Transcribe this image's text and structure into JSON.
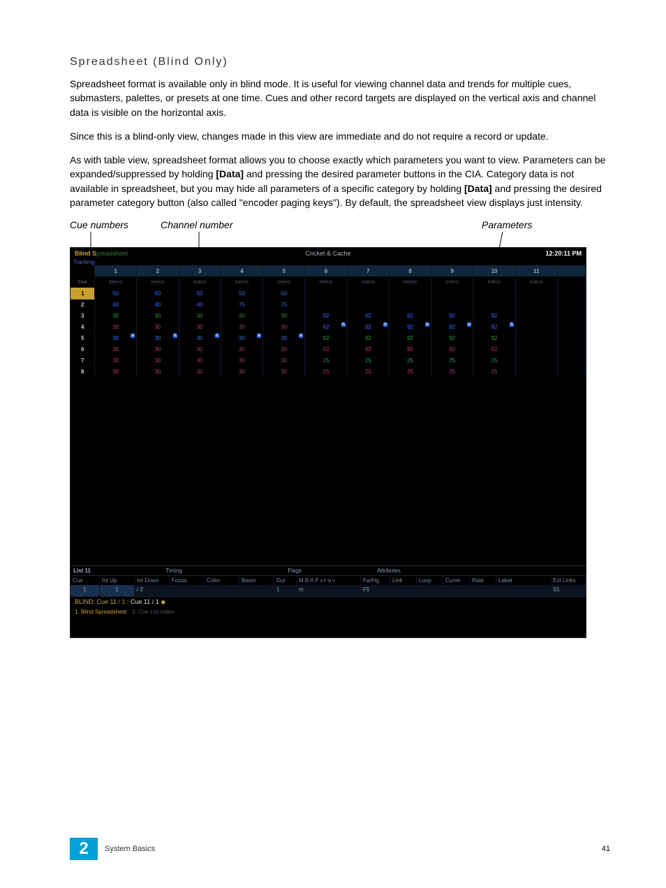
{
  "heading": "Spreadsheet (Blind Only)",
  "para1a": "Spreadsheet format is available only in blind mode. It is useful for viewing channel data and trends for multiple cues, submasters, palettes, or presets at one time. Cues and other record targets are displayed on the vertical axis and channel data is visible on the horizontal axis.",
  "para2": "Since this is a blind-only view, changes made in this view are immediate and do not require a record or update.",
  "para3a": "As with table view, spreadsheet format allows you to choose exactly which parameters you want to view. Parameters can be expanded/suppressed by holding ",
  "para3b": " and pressing the desired parameter buttons in the CIA. Category data is not available in spreadsheet, but you may hide all parameters of a specific category by holding ",
  "para3c": " and pressing the desired parameter category button (also called \"encoder paging keys\"). By default, the spreadsheet view displays just intensity.",
  "boldData": "[Data]",
  "callouts": {
    "cue": "Cue numbers",
    "channel": "Channel number",
    "params": "Parameters"
  },
  "ss": {
    "title_blind": "Blind S",
    "title_spread": "preadsheet",
    "showname": "Cricket & Cache",
    "time": "12:20:11 PM",
    "tracking": "Tracking",
    "channels": [
      "1",
      "2",
      "3",
      "4",
      "5",
      "6",
      "7",
      "8",
      "9",
      "10",
      "11"
    ],
    "paramLabel": "Intens",
    "cueHdr": "Cue",
    "rows": [
      {
        "cue": "1",
        "active": true,
        "cells": [
          {
            "v": "50",
            "c": "b"
          },
          {
            "v": "50",
            "c": "b"
          },
          {
            "v": "50",
            "c": "b"
          },
          {
            "v": "50",
            "c": "b"
          },
          {
            "v": "50",
            "c": "b"
          },
          {
            "v": "",
            "c": ""
          },
          {
            "v": "",
            "c": ""
          },
          {
            "v": "",
            "c": ""
          },
          {
            "v": "",
            "c": ""
          },
          {
            "v": "",
            "c": ""
          },
          {
            "v": "",
            "c": ""
          }
        ]
      },
      {
        "cue": "2",
        "cells": [
          {
            "v": "40",
            "c": "b"
          },
          {
            "v": "40",
            "c": "b"
          },
          {
            "v": "40",
            "c": "b"
          },
          {
            "v": "75",
            "c": "b"
          },
          {
            "v": "75",
            "c": "b"
          },
          {
            "v": "",
            "c": ""
          },
          {
            "v": "",
            "c": ""
          },
          {
            "v": "",
            "c": ""
          },
          {
            "v": "",
            "c": ""
          },
          {
            "v": "",
            "c": ""
          },
          {
            "v": "",
            "c": ""
          }
        ]
      },
      {
        "cue": "3",
        "cells": [
          {
            "v": "30",
            "c": "g"
          },
          {
            "v": "30",
            "c": "g"
          },
          {
            "v": "30",
            "c": "g"
          },
          {
            "v": "30",
            "c": "g"
          },
          {
            "v": "30",
            "c": "g"
          },
          {
            "v": "92",
            "c": "b"
          },
          {
            "v": "92",
            "c": "b"
          },
          {
            "v": "92",
            "c": "b"
          },
          {
            "v": "92",
            "c": "b"
          },
          {
            "v": "92",
            "c": "b"
          },
          {
            "v": "",
            "c": ""
          }
        ]
      },
      {
        "cue": "4",
        "cells": [
          {
            "v": "30",
            "c": "m"
          },
          {
            "v": "30",
            "c": "m"
          },
          {
            "v": "30",
            "c": "m"
          },
          {
            "v": "30",
            "c": "m"
          },
          {
            "v": "30",
            "c": "m"
          },
          {
            "v": "92",
            "c": "b",
            "a": true
          },
          {
            "v": "92",
            "c": "b",
            "a": true
          },
          {
            "v": "92",
            "c": "b",
            "a": true
          },
          {
            "v": "92",
            "c": "b",
            "a": true
          },
          {
            "v": "92",
            "c": "b",
            "a": true
          },
          {
            "v": "",
            "c": ""
          }
        ]
      },
      {
        "cue": "5",
        "cells": [
          {
            "v": "30",
            "c": "b",
            "a": true
          },
          {
            "v": "30",
            "c": "b",
            "a": true
          },
          {
            "v": "30",
            "c": "b",
            "a": true
          },
          {
            "v": "30",
            "c": "b",
            "a": true
          },
          {
            "v": "30",
            "c": "b",
            "a": true
          },
          {
            "v": "92",
            "c": "g"
          },
          {
            "v": "92",
            "c": "g"
          },
          {
            "v": "92",
            "c": "g"
          },
          {
            "v": "92",
            "c": "g"
          },
          {
            "v": "92",
            "c": "g"
          },
          {
            "v": "",
            "c": ""
          }
        ]
      },
      {
        "cue": "6",
        "cells": [
          {
            "v": "30",
            "c": "m"
          },
          {
            "v": "30",
            "c": "m"
          },
          {
            "v": "30",
            "c": "m"
          },
          {
            "v": "30",
            "c": "m"
          },
          {
            "v": "30",
            "c": "m"
          },
          {
            "v": "92",
            "c": "m"
          },
          {
            "v": "92",
            "c": "m"
          },
          {
            "v": "92",
            "c": "m"
          },
          {
            "v": "92",
            "c": "m"
          },
          {
            "v": "92",
            "c": "m"
          },
          {
            "v": "",
            "c": ""
          }
        ]
      },
      {
        "cue": "7",
        "cells": [
          {
            "v": "30",
            "c": "m"
          },
          {
            "v": "30",
            "c": "m"
          },
          {
            "v": "30",
            "c": "m"
          },
          {
            "v": "30",
            "c": "m"
          },
          {
            "v": "30",
            "c": "m"
          },
          {
            "v": "25",
            "c": "g"
          },
          {
            "v": "25",
            "c": "g"
          },
          {
            "v": "25",
            "c": "g"
          },
          {
            "v": "25",
            "c": "g"
          },
          {
            "v": "25",
            "c": "g"
          },
          {
            "v": "",
            "c": ""
          }
        ]
      },
      {
        "cue": "8",
        "cells": [
          {
            "v": "30",
            "c": "m"
          },
          {
            "v": "30",
            "c": "m"
          },
          {
            "v": "30",
            "c": "m"
          },
          {
            "v": "30",
            "c": "m"
          },
          {
            "v": "30",
            "c": "m"
          },
          {
            "v": "25",
            "c": "m"
          },
          {
            "v": "25",
            "c": "m"
          },
          {
            "v": "25",
            "c": "m"
          },
          {
            "v": "25",
            "c": "m"
          },
          {
            "v": "25",
            "c": "m"
          },
          {
            "v": "",
            "c": ""
          }
        ]
      }
    ],
    "groupHdrs": {
      "list": "List 11",
      "timing": "Timing",
      "flags": "Flags",
      "attributes": "Attributes"
    },
    "listCols": [
      "Cue",
      "Int Up",
      "Int Down",
      "Focus",
      "Color",
      "Beam",
      "Dur",
      "M B A P",
      "Fw/Hg",
      "Link",
      "Loop",
      "Curve",
      "Rate",
      "Label",
      "Ext Links"
    ],
    "flagsSmall": [
      "A",
      "F",
      "M",
      "V"
    ],
    "listRow": {
      "cue": "1",
      "intup": "1",
      "slash": "/",
      "intdown": "2",
      "dur": "1",
      "flags": "m",
      "fwhg": "F5",
      "label": "",
      "ext": "S1"
    },
    "cmd": {
      "prefix": "BLIND: Cue  11 / 1 :  ",
      "body": "Cue 11 / 1 ",
      "diamond": "◆"
    },
    "tabs": {
      "t1": "1. Blind Spreadsheet",
      "t2": "3. Cue List Index"
    }
  },
  "footer": {
    "chapter": "2",
    "label": "System Basics",
    "page": "41"
  }
}
